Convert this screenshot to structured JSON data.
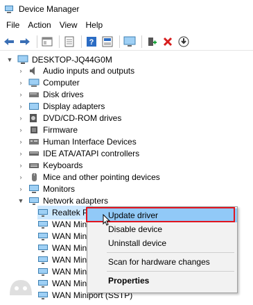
{
  "window": {
    "title": "Device Manager",
    "icon": "device-manager-icon"
  },
  "menu": [
    "File",
    "Action",
    "View",
    "Help"
  ],
  "toolbar": {
    "buttons": [
      "back-arrow-icon",
      "forward-arrow-icon",
      "show-hide-tree-icon",
      "properties-icon",
      "help-icon",
      "action-icon",
      "scan-monitor-icon",
      "add-driver-icon",
      "uninstall-x-icon",
      "download-icon"
    ]
  },
  "tree": {
    "root": "DESKTOP-JQ44G0M",
    "categories": [
      {
        "label": "Audio inputs and outputs",
        "icon": "speaker-icon"
      },
      {
        "label": "Computer",
        "icon": "computer-icon"
      },
      {
        "label": "Disk drives",
        "icon": "disk-icon"
      },
      {
        "label": "Display adapters",
        "icon": "display-icon"
      },
      {
        "label": "DVD/CD-ROM drives",
        "icon": "dvd-icon"
      },
      {
        "label": "Firmware",
        "icon": "firmware-icon"
      },
      {
        "label": "Human Interface Devices",
        "icon": "hid-icon"
      },
      {
        "label": "IDE ATA/ATAPI controllers",
        "icon": "ide-icon"
      },
      {
        "label": "Keyboards",
        "icon": "keyboard-icon"
      },
      {
        "label": "Mice and other pointing devices",
        "icon": "mouse-icon"
      },
      {
        "label": "Monitors",
        "icon": "monitor-icon"
      },
      {
        "label": "Network adapters",
        "icon": "network-icon"
      }
    ],
    "network_children": [
      "Realtek PC",
      "WAN Min",
      "WAN Min",
      "WAN Min",
      "WAN Min",
      "WAN Min",
      "WAN Miniport (PPTP)",
      "WAN Miniport (SSTP)"
    ]
  },
  "context_menu": {
    "items": [
      "Update driver",
      "Disable device",
      "Uninstall device",
      "Scan for hardware changes",
      "Properties"
    ],
    "highlighted": "Update driver"
  },
  "colors": {
    "highlight": "#91c9f7",
    "red_box": "#e0141e",
    "selection": "#cce8ff"
  }
}
